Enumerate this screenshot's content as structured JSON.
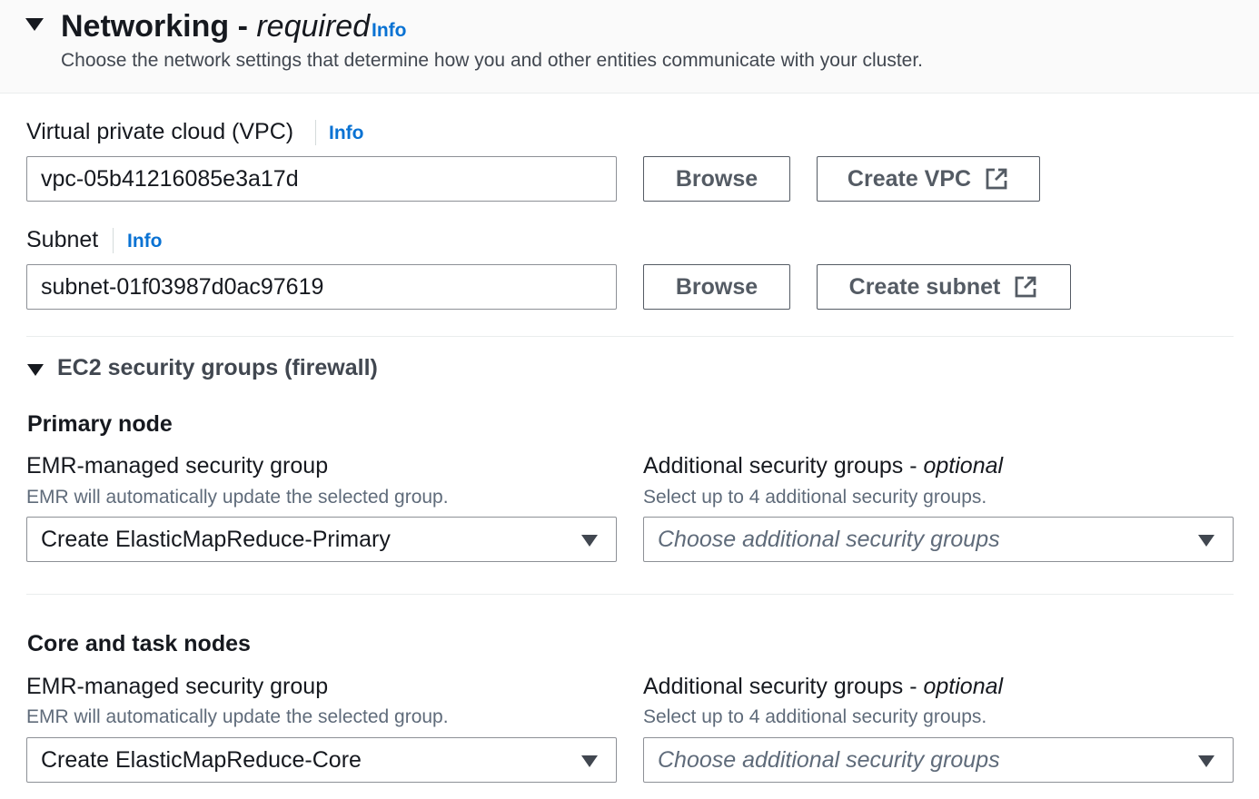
{
  "header": {
    "title": "Networking -",
    "title_suffix": "required",
    "info": "Info",
    "description": "Choose the network settings that determine how you and other entities communicate with your cluster."
  },
  "vpc": {
    "label": "Virtual private cloud (VPC)",
    "info": "Info",
    "value": "vpc-05b41216085e3a17d",
    "browse": "Browse",
    "create": "Create VPC"
  },
  "subnet": {
    "label": "Subnet",
    "info": "Info",
    "value": "subnet-01f03987d0ac97619",
    "browse": "Browse",
    "create": "Create subnet"
  },
  "security_groups": {
    "title": "EC2 security groups (firewall)",
    "primary": {
      "title": "Primary node",
      "emr_label": "EMR-managed security group",
      "emr_desc": "EMR will automatically update the selected group.",
      "emr_value": "Create ElasticMapReduce-Primary",
      "add_label": "Additional security groups -",
      "add_optional": "optional",
      "add_desc": "Select up to 4 additional security groups.",
      "add_placeholder": "Choose additional security groups"
    },
    "core": {
      "title": "Core and task nodes",
      "emr_label": "EMR-managed security group",
      "emr_desc": "EMR will automatically update the selected group.",
      "emr_value": "Create ElasticMapReduce-Core",
      "add_label": "Additional security groups -",
      "add_optional": "optional",
      "add_desc": "Select up to 4 additional security groups.",
      "add_placeholder": "Choose additional security groups"
    }
  },
  "icons": {
    "expand": "caret-down-icon",
    "external": "external-link-icon",
    "dropdown": "chevron-down-icon"
  },
  "colors": {
    "link": "#0972d3",
    "text": "#16191f",
    "muted": "#5f6b7a",
    "border": "#8d9096"
  }
}
